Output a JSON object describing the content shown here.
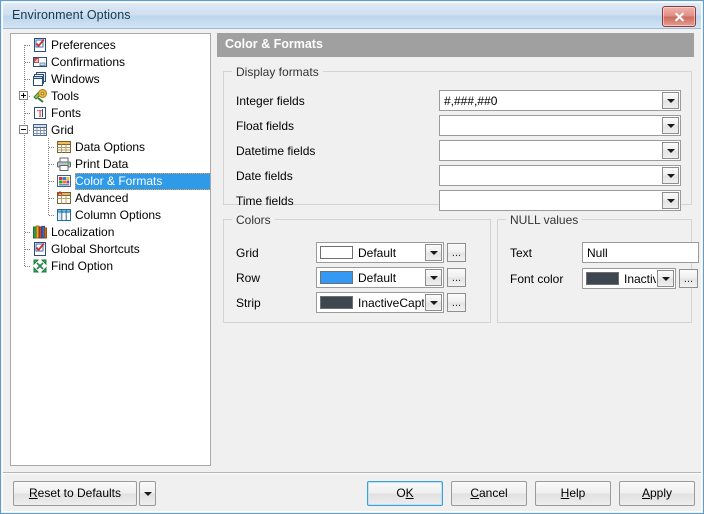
{
  "window": {
    "title": "Environment Options",
    "close_icon": "close-icon"
  },
  "tree": {
    "items": [
      {
        "label": "Preferences",
        "level": 0,
        "icon": "checkbox-document-icon",
        "expander": "none",
        "selected": false
      },
      {
        "label": "Confirmations",
        "level": 0,
        "icon": "confirm-dialog-icon",
        "expander": "none",
        "selected": false
      },
      {
        "label": "Windows",
        "level": 0,
        "icon": "windows-stack-icon",
        "expander": "none",
        "selected": false
      },
      {
        "label": "Tools",
        "level": 0,
        "icon": "tools-puzzle-icon",
        "expander": "plus",
        "selected": false
      },
      {
        "label": "Fonts",
        "level": 0,
        "icon": "font-letter-icon",
        "expander": "none",
        "selected": false
      },
      {
        "label": "Grid",
        "level": 0,
        "icon": "grid-table-icon",
        "expander": "minus",
        "selected": false
      },
      {
        "label": "Data Options",
        "level": 1,
        "icon": "data-options-icon",
        "expander": "none",
        "selected": false
      },
      {
        "label": "Print Data",
        "level": 1,
        "icon": "printer-icon",
        "expander": "none",
        "selected": false
      },
      {
        "label": "Color & Formats",
        "level": 1,
        "icon": "color-palette-icon",
        "expander": "none",
        "selected": true
      },
      {
        "label": "Advanced",
        "level": 1,
        "icon": "advanced-grid-icon",
        "expander": "none",
        "selected": false
      },
      {
        "label": "Column Options",
        "level": 1,
        "icon": "column-options-icon",
        "expander": "none",
        "selected": false
      },
      {
        "label": "Localization",
        "level": 0,
        "icon": "localization-books-icon",
        "expander": "none",
        "selected": false
      },
      {
        "label": "Global Shortcuts",
        "level": 0,
        "icon": "shortcuts-check-icon",
        "expander": "none",
        "selected": false
      },
      {
        "label": "Find Option",
        "level": 0,
        "icon": "find-option-icon",
        "expander": "none",
        "selected": false
      }
    ]
  },
  "content": {
    "header": "Color & Formats",
    "display_formats": {
      "title": "Display formats",
      "fields": [
        {
          "label": "Integer fields",
          "value": "#,###,##0"
        },
        {
          "label": "Float fields",
          "value": ""
        },
        {
          "label": "Datetime fields",
          "value": ""
        },
        {
          "label": "Date fields",
          "value": ""
        },
        {
          "label": "Time fields",
          "value": ""
        }
      ]
    },
    "colors": {
      "title": "Colors",
      "rows": [
        {
          "label": "Grid",
          "swatch": "#ffffff",
          "value": "Default"
        },
        {
          "label": "Row",
          "swatch": "#3399f5",
          "value": "Default"
        },
        {
          "label": "Strip",
          "swatch": "#3e4750",
          "value": "InactiveCaptionTe"
        }
      ],
      "ellipsis_label": "..."
    },
    "null_values": {
      "title": "NULL values",
      "text_label": "Text",
      "text_value": "Null",
      "font_color_label": "Font color",
      "font_color_swatch": "#3e4750",
      "font_color_value": "InactiveC",
      "ellipsis_label": "..."
    }
  },
  "footer": {
    "reset": {
      "pre": "",
      "accel": "R",
      "post": "eset to Defaults"
    },
    "ok": {
      "pre": "O",
      "accel": "K",
      "post": ""
    },
    "cancel": {
      "pre": "",
      "accel": "C",
      "post": "ancel"
    },
    "help": {
      "pre": "",
      "accel": "H",
      "post": "elp"
    },
    "apply": {
      "pre": "",
      "accel": "A",
      "post": "pply"
    }
  }
}
